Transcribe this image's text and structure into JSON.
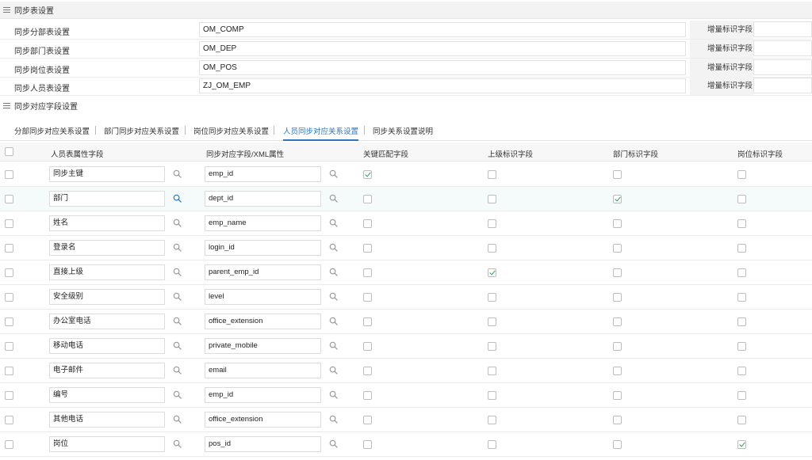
{
  "sections": {
    "sync_table": "同步表设置",
    "sync_fields": "同步对应字段设置"
  },
  "sync_rows": [
    {
      "label": "同步分部表设置",
      "value": "OM_COMP",
      "flag_label": "增量标识字段",
      "flag_value": ""
    },
    {
      "label": "同步部门表设置",
      "value": "OM_DEP",
      "flag_label": "增量标识字段",
      "flag_value": ""
    },
    {
      "label": "同步岗位表设置",
      "value": "OM_POS",
      "flag_label": "增量标识字段",
      "flag_value": ""
    },
    {
      "label": "同步人员表设置",
      "value": "ZJ_OM_EMP",
      "flag_label": "增量标识字段",
      "flag_value": ""
    }
  ],
  "tabs": [
    {
      "label": "分部同步对应关系设置",
      "active": false
    },
    {
      "label": "部门同步对应关系设置",
      "active": false
    },
    {
      "label": "岗位同步对应关系设置",
      "active": false
    },
    {
      "label": "人员同步对应关系设置",
      "active": true
    },
    {
      "label": "同步关系设置说明",
      "active": false
    }
  ],
  "columns": [
    "人员表属性字段",
    "同步对应字段/XML属性",
    "关键匹配字段",
    "上级标识字段",
    "部门标识字段",
    "岗位标识字段"
  ],
  "rows": [
    {
      "attr": "同步主键",
      "field": "emp_id",
      "key": true,
      "parent": false,
      "dept": false,
      "pos": false
    },
    {
      "attr": "部门",
      "field": "dept_id",
      "key": false,
      "parent": false,
      "dept": true,
      "pos": false
    },
    {
      "attr": "姓名",
      "field": "emp_name",
      "key": false,
      "parent": false,
      "dept": false,
      "pos": false
    },
    {
      "attr": "登录名",
      "field": "login_id",
      "key": false,
      "parent": false,
      "dept": false,
      "pos": false
    },
    {
      "attr": "直接上级",
      "field": "parent_emp_id",
      "key": false,
      "parent": true,
      "dept": false,
      "pos": false
    },
    {
      "attr": "安全级别",
      "field": "level",
      "key": false,
      "parent": false,
      "dept": false,
      "pos": false
    },
    {
      "attr": "办公室电话",
      "field": "office_extension",
      "key": false,
      "parent": false,
      "dept": false,
      "pos": false
    },
    {
      "attr": "移动电话",
      "field": "private_mobile",
      "key": false,
      "parent": false,
      "dept": false,
      "pos": false
    },
    {
      "attr": "电子邮件",
      "field": "email",
      "key": false,
      "parent": false,
      "dept": false,
      "pos": false
    },
    {
      "attr": "编号",
      "field": "emp_id",
      "key": false,
      "parent": false,
      "dept": false,
      "pos": false
    },
    {
      "attr": "其他电话",
      "field": "office_extension",
      "key": false,
      "parent": false,
      "dept": false,
      "pos": false
    },
    {
      "attr": "岗位",
      "field": "pos_id",
      "key": false,
      "parent": false,
      "dept": false,
      "pos": true
    }
  ],
  "highlight_row": 1,
  "colors": {
    "accent": "#2b77c4",
    "check": "#2e9e5b",
    "highlight": "#f5fbfb"
  },
  "icons": {
    "section": "menu-icon",
    "lookup": "search-icon"
  }
}
